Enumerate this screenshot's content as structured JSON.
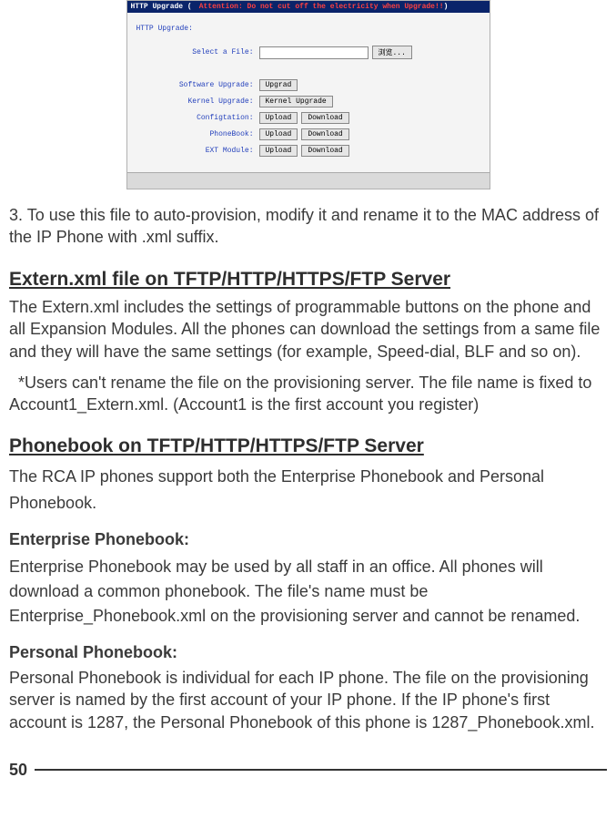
{
  "screenshot": {
    "titlebar_label": "HTTP Upgrade",
    "titlebar_warn": "Attention: Do not cut off the electricity when Upgrade!!",
    "http_upgrade_label": "HTTP Upgrade:",
    "select_file_label": "Select a File:",
    "browse_btn": "浏览...",
    "rows": {
      "software": {
        "label": "Software Upgrade:",
        "a": "Upgrad"
      },
      "kernel": {
        "label": "Kernel Upgrade:",
        "a": "Kernel Upgrade"
      },
      "config": {
        "label": "Configtation:",
        "a": "Upload",
        "b": "Download"
      },
      "phonebook": {
        "label": "PhoneBook:",
        "a": "Upload",
        "b": "Download"
      },
      "ext": {
        "label": "EXT Module:",
        "a": "Upload",
        "b": "Download"
      }
    }
  },
  "instruction3": "3. To use this file to auto-provision, modify it and rename it to the MAC address of the IP Phone with .xml suffix.",
  "extern_heading": "Extern.xml file on TFTP/HTTP/HTTPS/FTP Server",
  "extern_p1": "The Extern.xml includes the settings of programmable buttons on the phone and all Expansion Modules. All the phones can download the settings from a same file and they will have the same settings (for example, Speed-dial, BLF and so on).",
  "extern_note": "  *Users can't rename the file on the provisioning server. The file name is fixed to Account1_Extern.xml. (Account1 is the first account you register)",
  "phonebook_heading": "Phonebook on TFTP/HTTP/HTTPS/FTP Server",
  "phonebook_intro": "The RCA IP phones support both the Enterprise Phonebook and Personal Phonebook.",
  "enterprise_sub": "Enterprise Phonebook:",
  "enterprise_p": "Enterprise Phonebook may be used by all staff in an office. All phones will download a common phonebook. The file's name must be Enterprise_Phonebook.xml on the provisioning server and cannot be renamed.",
  "personal_sub": "Personal Phonebook:",
  "personal_p": "Personal Phonebook is individual for each IP phone. The file on the provisioning server is named by the first account of your IP phone. If the IP phone's first account is 1287, the Personal Phonebook of this phone is 1287_Phonebook.xml.",
  "page_number": "50"
}
